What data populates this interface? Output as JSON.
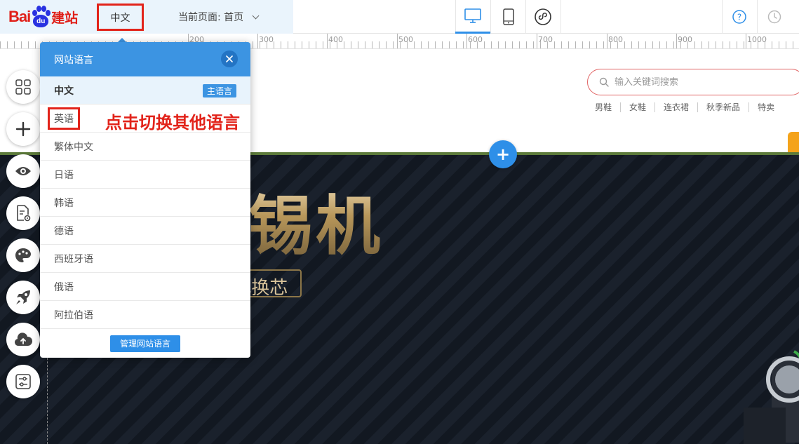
{
  "logo": {
    "text_latin": "Bai",
    "text_paw": "du",
    "text_cn": "建站"
  },
  "header": {
    "language": "中文",
    "current_page": "当前页面: 首页"
  },
  "ruler": {
    "labels": [
      "200",
      "300",
      "400",
      "500",
      "600",
      "700",
      "800",
      "900",
      "1000"
    ]
  },
  "site": {
    "search_placeholder": "输入关键词搜索",
    "hot_words": [
      "男鞋",
      "女鞋",
      "连衣裙",
      "秋季新品",
      "特卖"
    ]
  },
  "banner": {
    "title": "自动焊锡机",
    "subtitle": "智能液晶屏显示 插拔式换芯"
  },
  "language_popup": {
    "title": "网站语言",
    "primary_language": "中文",
    "primary_badge": "主语言",
    "languages": [
      "英语",
      "繁体中文",
      "日语",
      "韩语",
      "德语",
      "西班牙语",
      "俄语",
      "阿拉伯语"
    ],
    "manage_label": "管理网站语言"
  },
  "annotation": "点击切换其他语言",
  "colors": {
    "accent": "#2e8fe8",
    "highlight": "#e2231a",
    "popup_header": "#3c94e2"
  },
  "icons": {
    "toolbar": [
      "grid-icon",
      "plus-icon",
      "eye-icon",
      "page-settings-icon",
      "palette-icon",
      "rocket-icon",
      "cloud-upload-icon",
      "sliders-icon"
    ],
    "devices": [
      "desktop-icon",
      "mobile-icon",
      "mini-program-icon"
    ],
    "right": [
      "help-icon",
      "history-icon"
    ]
  }
}
